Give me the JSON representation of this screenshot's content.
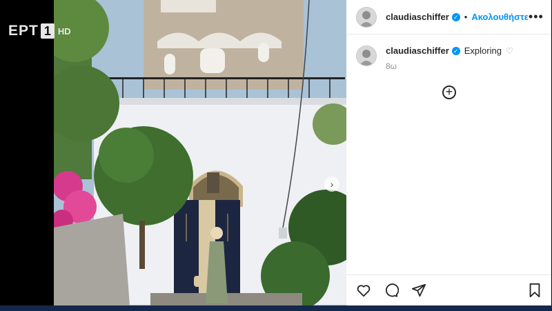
{
  "broadcast": {
    "channel": "ΕΡΤ",
    "number": "1",
    "quality": "HD"
  },
  "post": {
    "username": "claudiaschiffer",
    "follow_separator": "•",
    "follow_label": "Ακολουθήστε",
    "more_label": "•••",
    "caption_username": "claudiaschiffer",
    "caption_text": "Exploring",
    "time_ago": "8ω",
    "add_comment_symbol": "+",
    "carousel_next_symbol": "›"
  },
  "icons": {
    "verified": "verified-badge-icon",
    "like": "heart-icon",
    "comment": "comment-icon",
    "share": "send-icon",
    "save": "bookmark-icon"
  },
  "colors": {
    "link": "#0095f6",
    "text": "#262626",
    "muted": "#8e8e8e",
    "border": "#e6e6e6",
    "bar": "#13284a"
  }
}
